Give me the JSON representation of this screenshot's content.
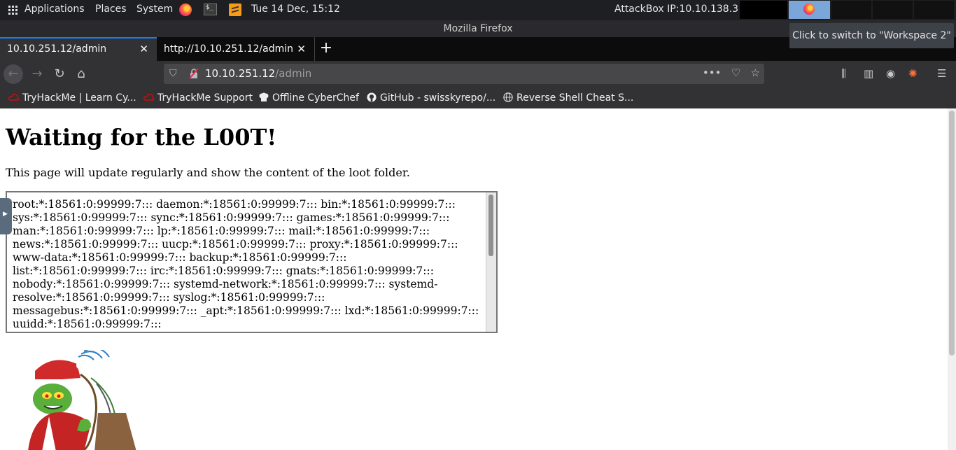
{
  "panel": {
    "applications": "Applications",
    "places": "Places",
    "system": "System",
    "clock": "Tue 14 Dec, 15:12",
    "attackbox": "AttackBox IP:10.10.138.3"
  },
  "window": {
    "title": "Mozilla Firefox"
  },
  "tooltip": "Click to switch to \"Workspace 2\"",
  "tabs": [
    {
      "label": "10.10.251.12/admin",
      "active": true
    },
    {
      "label": "http://10.10.251.12/admin",
      "active": false
    }
  ],
  "urlbar": {
    "host": "10.10.251.12",
    "path": "/admin"
  },
  "bookmarks": [
    {
      "label": "TryHackMe | Learn Cy...",
      "icon": "tryhackme-icon"
    },
    {
      "label": "TryHackMe Support",
      "icon": "tryhackme-icon"
    },
    {
      "label": "Offline CyberChef",
      "icon": "chef-hat-icon"
    },
    {
      "label": "GitHub - swisskyrepo/...",
      "icon": "github-icon"
    },
    {
      "label": "Reverse Shell Cheat S...",
      "icon": "globe-icon"
    }
  ],
  "page": {
    "heading": "Waiting for the L00T!",
    "description": "This page will update regularly and show the content of the loot folder.",
    "loot": "root:*:18561:0:99999:7::: daemon:*:18561:0:99999:7::: bin:*:18561:0:99999:7::: sys:*:18561:0:99999:7::: sync:*:18561:0:99999:7::: games:*:18561:0:99999:7::: man:*:18561:0:99999:7::: lp:*:18561:0:99999:7::: mail:*:18561:0:99999:7::: news:*:18561:0:99999:7::: uucp:*:18561:0:99999:7::: proxy:*:18561:0:99999:7::: www-data:*:18561:0:99999:7::: backup:*:18561:0:99999:7::: list:*:18561:0:99999:7::: irc:*:18561:0:99999:7::: gnats:*:18561:0:99999:7::: nobody:*:18561:0:99999:7::: systemd-network:*:18561:0:99999:7::: systemd-resolve:*:18561:0:99999:7::: syslog:*:18561:0:99999:7::: messagebus:*:18561:0:99999:7::: _apt:*:18561:0:99999:7::: lxd:*:18561:0:99999:7::: uuidd:*:18561:0:99999:7:::"
  },
  "colors": {
    "accent": "#0a84ff",
    "panel": "#1e1f22",
    "toolbar": "#323234",
    "workspace_active": "#7aa6da"
  }
}
